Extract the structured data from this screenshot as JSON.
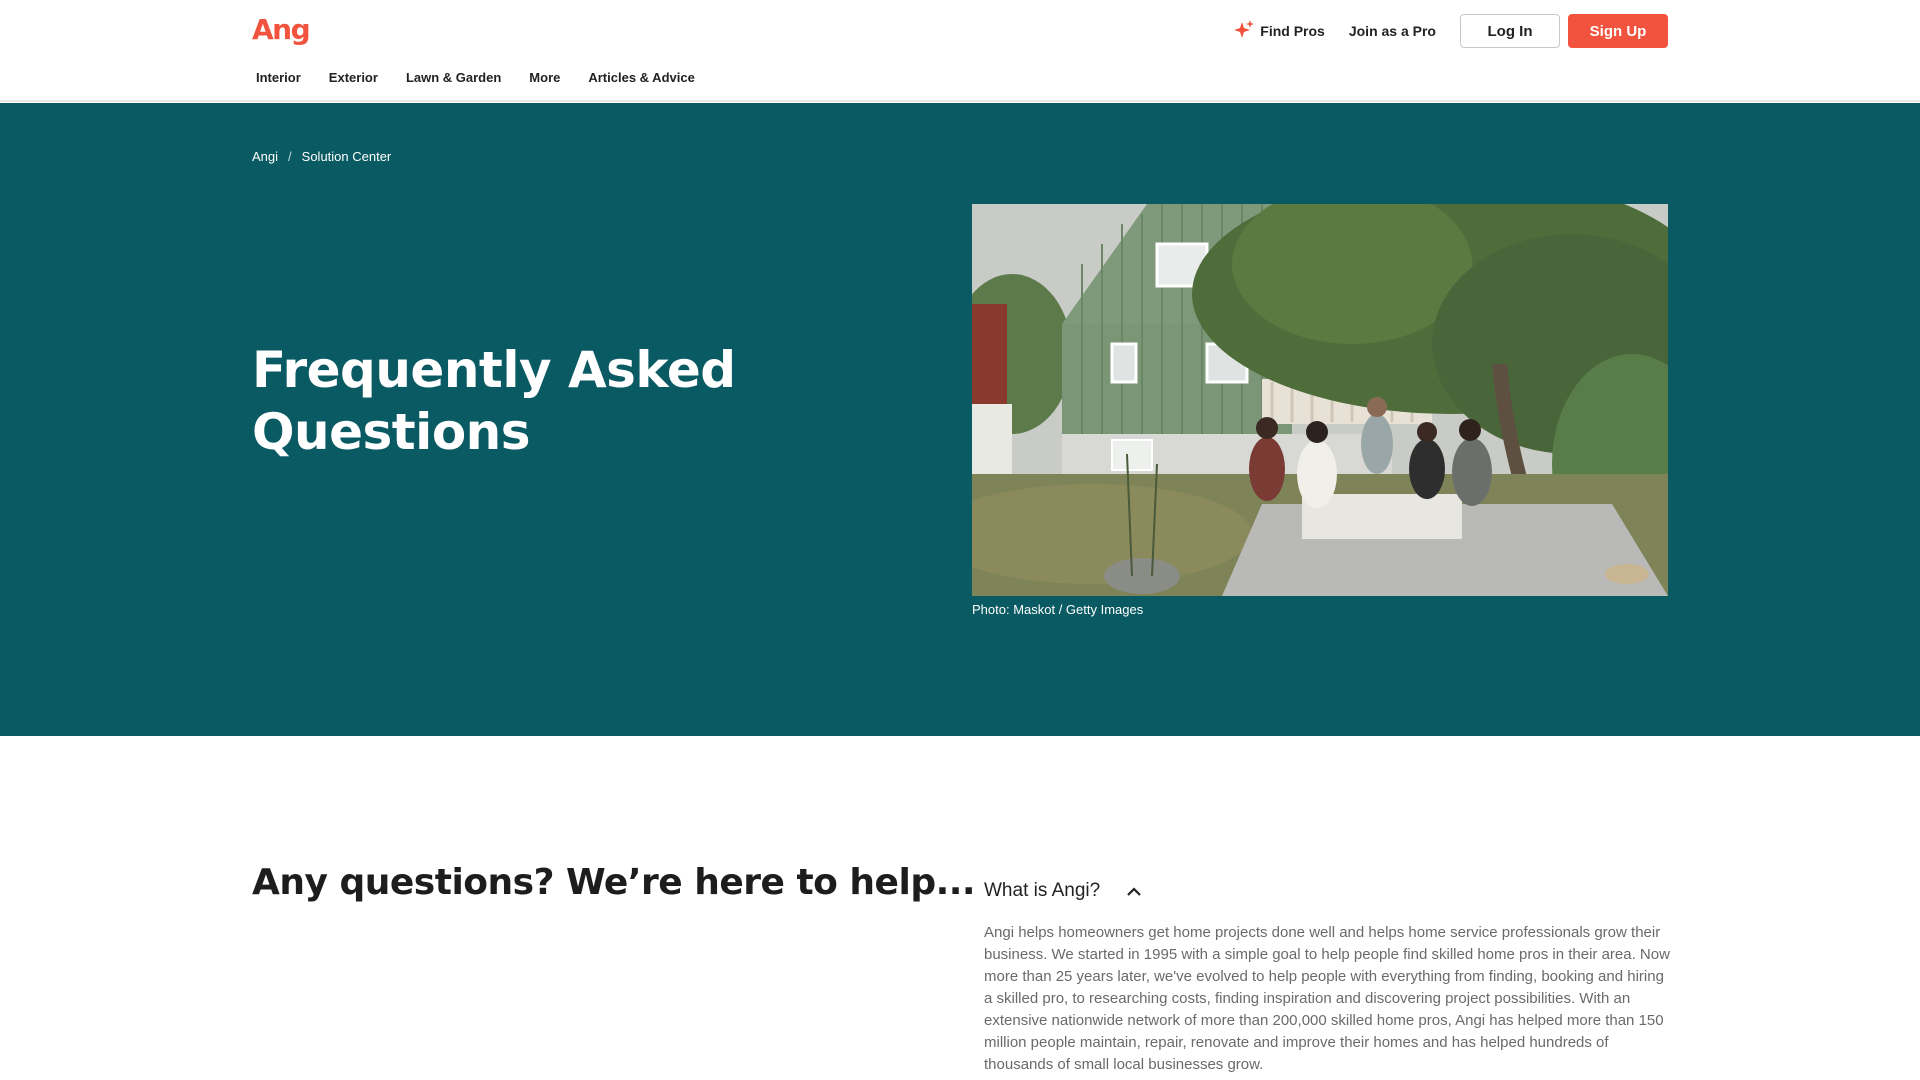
{
  "brand": {
    "logo_text": "Angi",
    "accent": "#f2533e",
    "hero_bg": "#0a5a63"
  },
  "header": {
    "find_pros": "Find Pros",
    "join_pro": "Join as a Pro",
    "login": "Log In",
    "signup": "Sign Up"
  },
  "nav": {
    "items": [
      "Interior",
      "Exterior",
      "Lawn & Garden",
      "More",
      "Articles & Advice"
    ]
  },
  "hero": {
    "breadcrumb": [
      "Angi",
      "Solution Center"
    ],
    "breadcrumb_sep": "/",
    "title": "Frequently Asked Questions",
    "photo_caption": "Photo: Maskot / Getty Images"
  },
  "faq": {
    "heading": "Any questions? We’re here to help...",
    "question": "What is Angi?",
    "answer": "Angi helps homeowners get home projects done well and helps home service professionals grow their business. We started in 1995 with a simple goal to help people find skilled home pros in their area. Now more than 25 years later, we've evolved to help people with everything from finding, booking and hiring a skilled pro, to researching costs, finding inspiration and discovering project possibilities. With an extensive nationwide network of more than 200,000 skilled home pros, Angi has helped more than 150 million people maintain, repair, renovate and improve their homes and has helped hundreds of thousands of small local businesses grow."
  }
}
